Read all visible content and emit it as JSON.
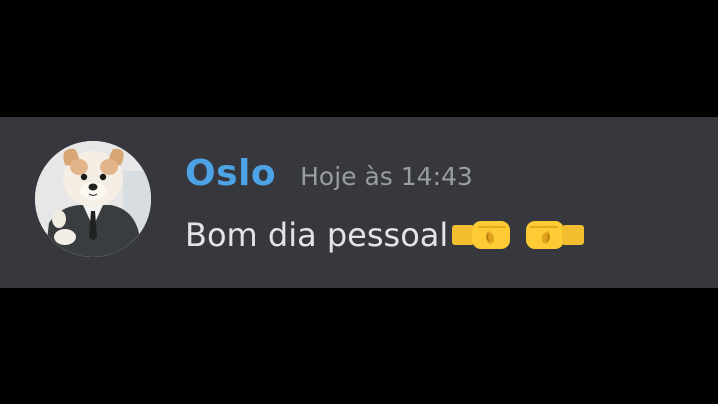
{
  "message": {
    "author": "Oslo",
    "timestamp": "Hoje às 14:43",
    "content": "Bom dia pessoal",
    "emojis": [
      "right-facing-fist-icon",
      "left-facing-fist-icon"
    ],
    "author_color": "#4ea3e6",
    "background_color": "#36383d"
  }
}
